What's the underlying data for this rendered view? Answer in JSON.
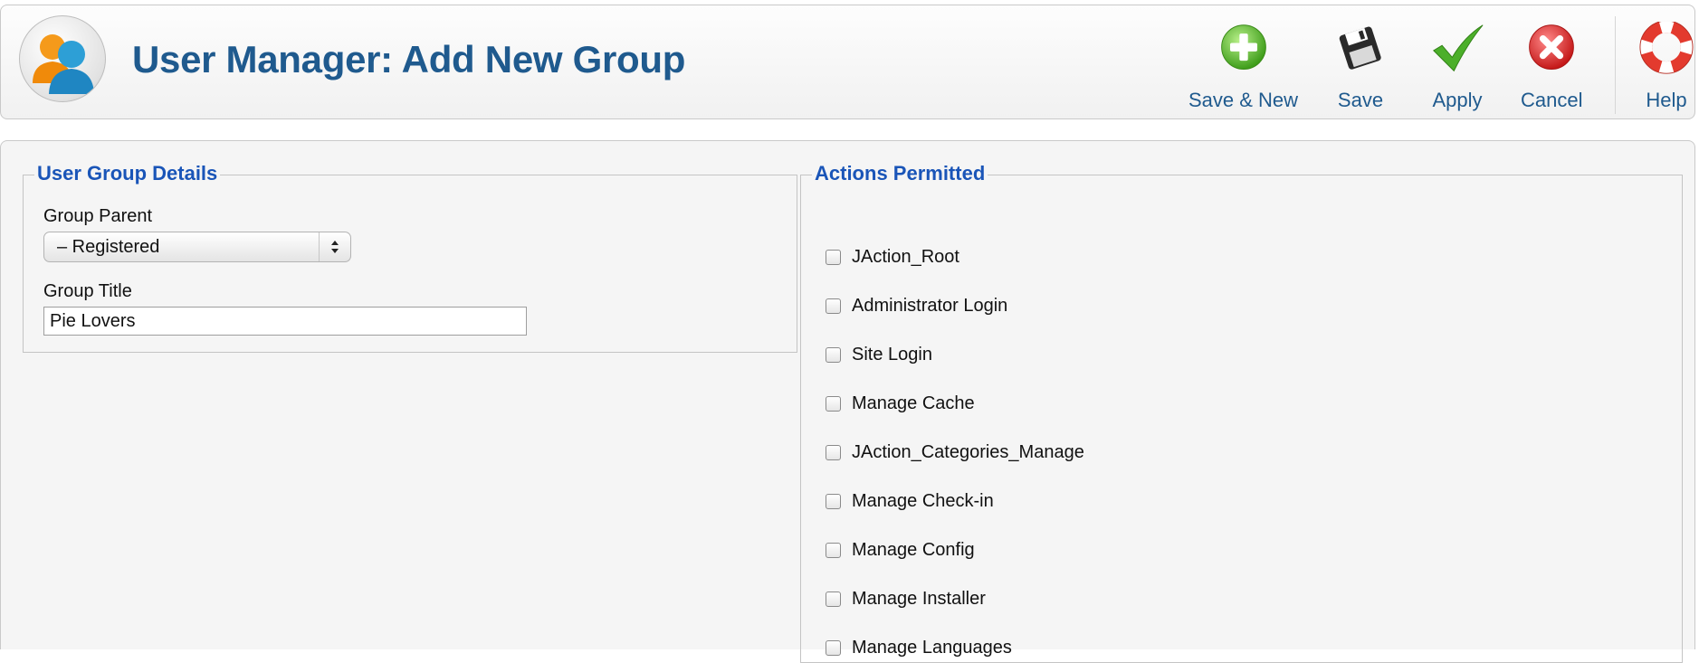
{
  "header": {
    "title": "User Manager: Add New Group",
    "icon": "user-group-icon"
  },
  "toolbar": {
    "buttons": [
      {
        "label": "Save & New",
        "icon": "plus-circle-icon",
        "color": "#5cb82c"
      },
      {
        "label": "Save",
        "icon": "floppy-disk-icon",
        "color": "#222222"
      },
      {
        "label": "Apply",
        "icon": "checkmark-icon",
        "color": "#4caf2a"
      },
      {
        "label": "Cancel",
        "icon": "cancel-circle-icon",
        "color": "#d92b2b"
      },
      {
        "label": "Help",
        "icon": "lifebuoy-icon",
        "color": "#e33a2e"
      }
    ]
  },
  "details": {
    "legend": "User Group Details",
    "group_parent_label": "Group Parent",
    "group_parent_value": "– Registered",
    "group_title_label": "Group Title",
    "group_title_value": "Pie Lovers"
  },
  "actions": {
    "legend": "Actions Permitted",
    "items": [
      {
        "label": "JAction_Root",
        "checked": false
      },
      {
        "label": "Administrator Login",
        "checked": false
      },
      {
        "label": "Site Login",
        "checked": false
      },
      {
        "label": "Manage Cache",
        "checked": false
      },
      {
        "label": "JAction_Categories_Manage",
        "checked": false
      },
      {
        "label": "Manage Check-in",
        "checked": false
      },
      {
        "label": "Manage Config",
        "checked": false
      },
      {
        "label": "Manage Installer",
        "checked": false
      },
      {
        "label": "Manage Languages",
        "checked": false
      }
    ]
  },
  "colors": {
    "title": "#1f5a8e",
    "legend": "#1a55b8",
    "panel_background": "#f5f5f5"
  }
}
